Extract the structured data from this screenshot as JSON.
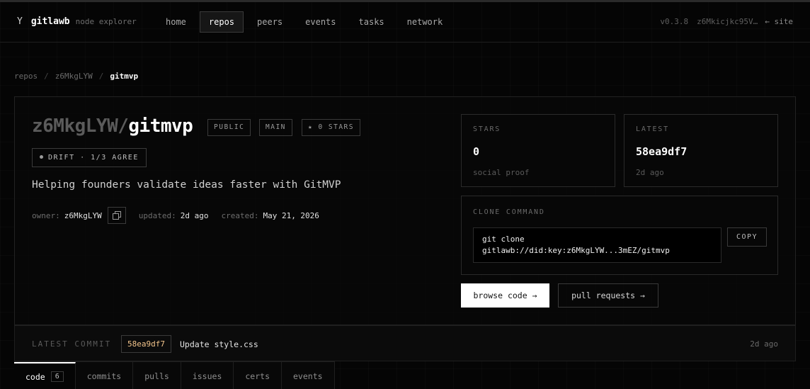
{
  "header": {
    "brand_icon": "Y",
    "brand_name": "gitlawb",
    "brand_sub": "node explorer",
    "nav": [
      "home",
      "repos",
      "peers",
      "events",
      "tasks",
      "network"
    ],
    "nav_active": "repos",
    "version": "v0.3.8",
    "node_id": "z6Mkicjkc95V…",
    "site_link": "← site"
  },
  "breadcrumb": [
    "repos",
    "z6MkgLYW",
    "gitmvp"
  ],
  "repo": {
    "owner": "z6MkgLYW/",
    "name": "gitmvp",
    "badges": [
      "PUBLIC",
      "MAIN",
      "★ 0 STARS"
    ],
    "drift": "DRIFT · 1/3 AGREE",
    "description": "Helping founders validate ideas faster with GitMVP",
    "meta": {
      "owner_label": "owner:",
      "owner_value": "z6MkgLYW",
      "updated_label": "updated:",
      "updated_value": "2d ago",
      "created_label": "created:",
      "created_value": "May 21, 2026"
    }
  },
  "stats": {
    "stars": {
      "label": "STARS",
      "value": "0",
      "sub": "social proof"
    },
    "latest": {
      "label": "LATEST",
      "value": "58ea9df7",
      "sub": "2d ago"
    }
  },
  "clone": {
    "label": "CLONE COMMAND",
    "line1": "git clone",
    "line2": "gitlawb://did:key:z6MkgLYW...3mEZ/gitmvp",
    "copy_label": "COPY"
  },
  "actions": {
    "browse": "browse code →",
    "pulls": "pull requests →"
  },
  "commit": {
    "label": "LATEST COMMIT",
    "sha": "58ea9df7",
    "message": "Update style.css",
    "time": "2d ago"
  },
  "tabs": [
    {
      "label": "code",
      "count": "6"
    },
    {
      "label": "commits"
    },
    {
      "label": "pulls"
    },
    {
      "label": "issues"
    },
    {
      "label": "certs"
    },
    {
      "label": "events"
    }
  ],
  "colors": {
    "background": "#050505",
    "accent_white": "#ffffff",
    "sha_color": "#f2c48b",
    "border": "#2a2a2a"
  }
}
